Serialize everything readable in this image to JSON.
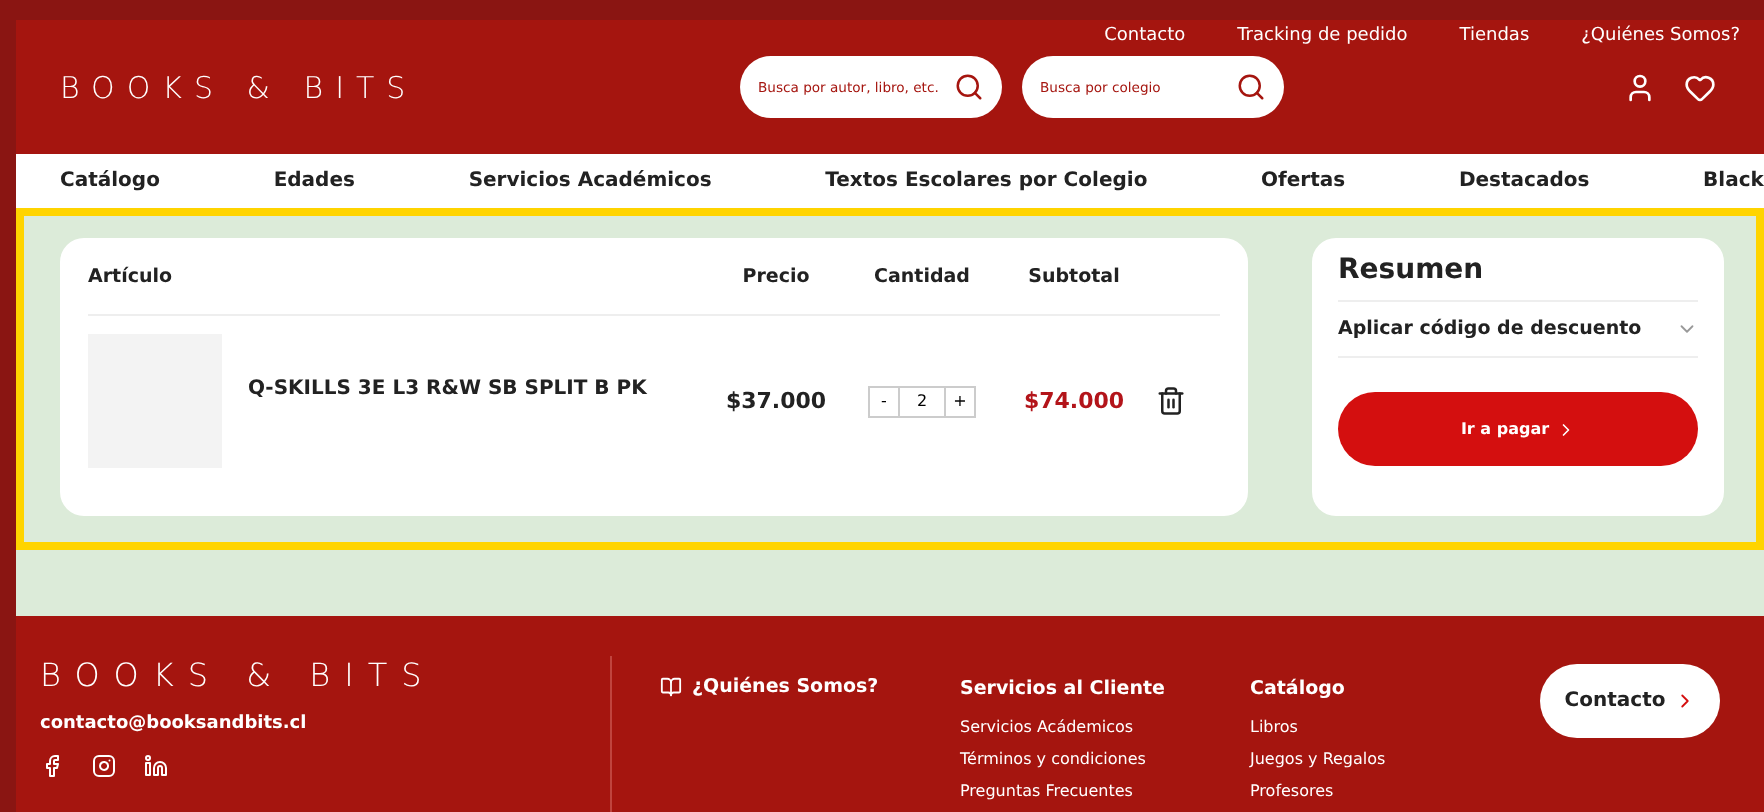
{
  "top_links": [
    "Contacto",
    "Tracking de pedido",
    "Tiendas",
    "¿Quiénes Somos?"
  ],
  "logo": "BOOKS & BITS",
  "searches": [
    {
      "placeholder": "Busca por autor, libro, etc."
    },
    {
      "placeholder": "Busca por colegio"
    }
  ],
  "nav": [
    "Catálogo",
    "Edades",
    "Servicios Académicos",
    "Textos Escolares por Colegio",
    "Ofertas",
    "Destacados",
    "Black"
  ],
  "cart": {
    "columns": [
      "Artículo",
      "Precio",
      "Cantidad",
      "Subtotal"
    ],
    "rows": [
      {
        "name": "Q-SKILLS 3E L3 R&W SB SPLIT B PK",
        "price": "$37.000",
        "minus": "-",
        "qty": "2",
        "plus": "+",
        "subtotal": "$74.000"
      }
    ]
  },
  "summary": {
    "title": "Resumen",
    "discount": {
      "label": "Aplicar código de descuento",
      "expanded": false
    },
    "checkout": "Ir a pagar"
  },
  "footer": {
    "logo": "BOOKS & BITS",
    "email": "contacto@booksandbits.cl",
    "about": "¿Quiénes Somos?",
    "columns": [
      {
        "title": "Servicios al Cliente",
        "links": [
          "Servicios Acádemicos",
          "Términos y condiciones",
          "Preguntas Frecuentes"
        ]
      },
      {
        "title": "Catálogo",
        "links": [
          "Libros",
          "Juegos y Regalos",
          "Profesores"
        ]
      }
    ],
    "contact": "Contacto"
  }
}
